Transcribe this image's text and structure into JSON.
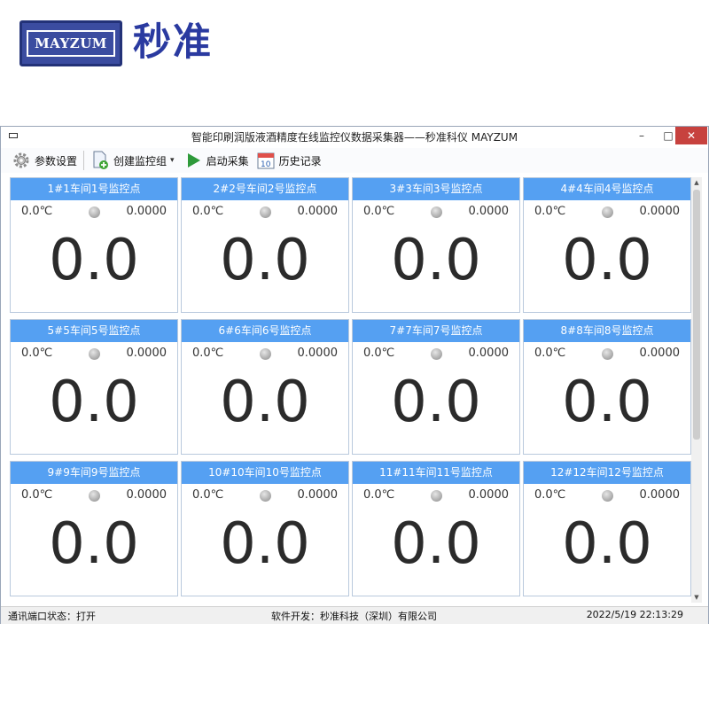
{
  "brand": {
    "logo_text": "MAYZUM",
    "name_cn": "秒准",
    "color": "#2a3aa0"
  },
  "window": {
    "title": "智能印刷润版液酒精度在线监控仪数据采集器——秒准科仪 MAYZUM",
    "controls": {
      "minimize": "–",
      "maximize": "□",
      "close": "✕"
    }
  },
  "toolbar": {
    "settings": "参数设置",
    "create_group": "创建监控组",
    "start": "启动采集",
    "history": "历史记录"
  },
  "panels": [
    {
      "title": "1#1车间1号监控点",
      "temp": "0.0℃",
      "value": "0.0000",
      "reading": "0.0"
    },
    {
      "title": "2#2号车间2号监控点",
      "temp": "0.0℃",
      "value": "0.0000",
      "reading": "0.0"
    },
    {
      "title": "3#3车间3号监控点",
      "temp": "0.0℃",
      "value": "0.0000",
      "reading": "0.0"
    },
    {
      "title": "4#4车间4号监控点",
      "temp": "0.0℃",
      "value": "0.0000",
      "reading": "0.0"
    },
    {
      "title": "5#5车间5号监控点",
      "temp": "0.0℃",
      "value": "0.0000",
      "reading": "0.0"
    },
    {
      "title": "6#6车间6号监控点",
      "temp": "0.0℃",
      "value": "0.0000",
      "reading": "0.0"
    },
    {
      "title": "7#7车间7号监控点",
      "temp": "0.0℃",
      "value": "0.0000",
      "reading": "0.0"
    },
    {
      "title": "8#8车间8号监控点",
      "temp": "0.0℃",
      "value": "0.0000",
      "reading": "0.0"
    },
    {
      "title": "9#9车间9号监控点",
      "temp": "0.0℃",
      "value": "0.0000",
      "reading": "0.0"
    },
    {
      "title": "10#10车间10号监控点",
      "temp": "0.0℃",
      "value": "0.0000",
      "reading": "0.0"
    },
    {
      "title": "11#11车间11号监控点",
      "temp": "0.0℃",
      "value": "0.0000",
      "reading": "0.0"
    },
    {
      "title": "12#12车间12号监控点",
      "temp": "0.0℃",
      "value": "0.0000",
      "reading": "0.0"
    }
  ],
  "status": {
    "port": "通讯端口状态：打开",
    "developer": "软件开发：秒准科技（深圳）有限公司",
    "datetime": "2022/5/19 22:13:29"
  },
  "colors": {
    "panel_header": "#55a0f2",
    "close_button": "#c7423e"
  }
}
